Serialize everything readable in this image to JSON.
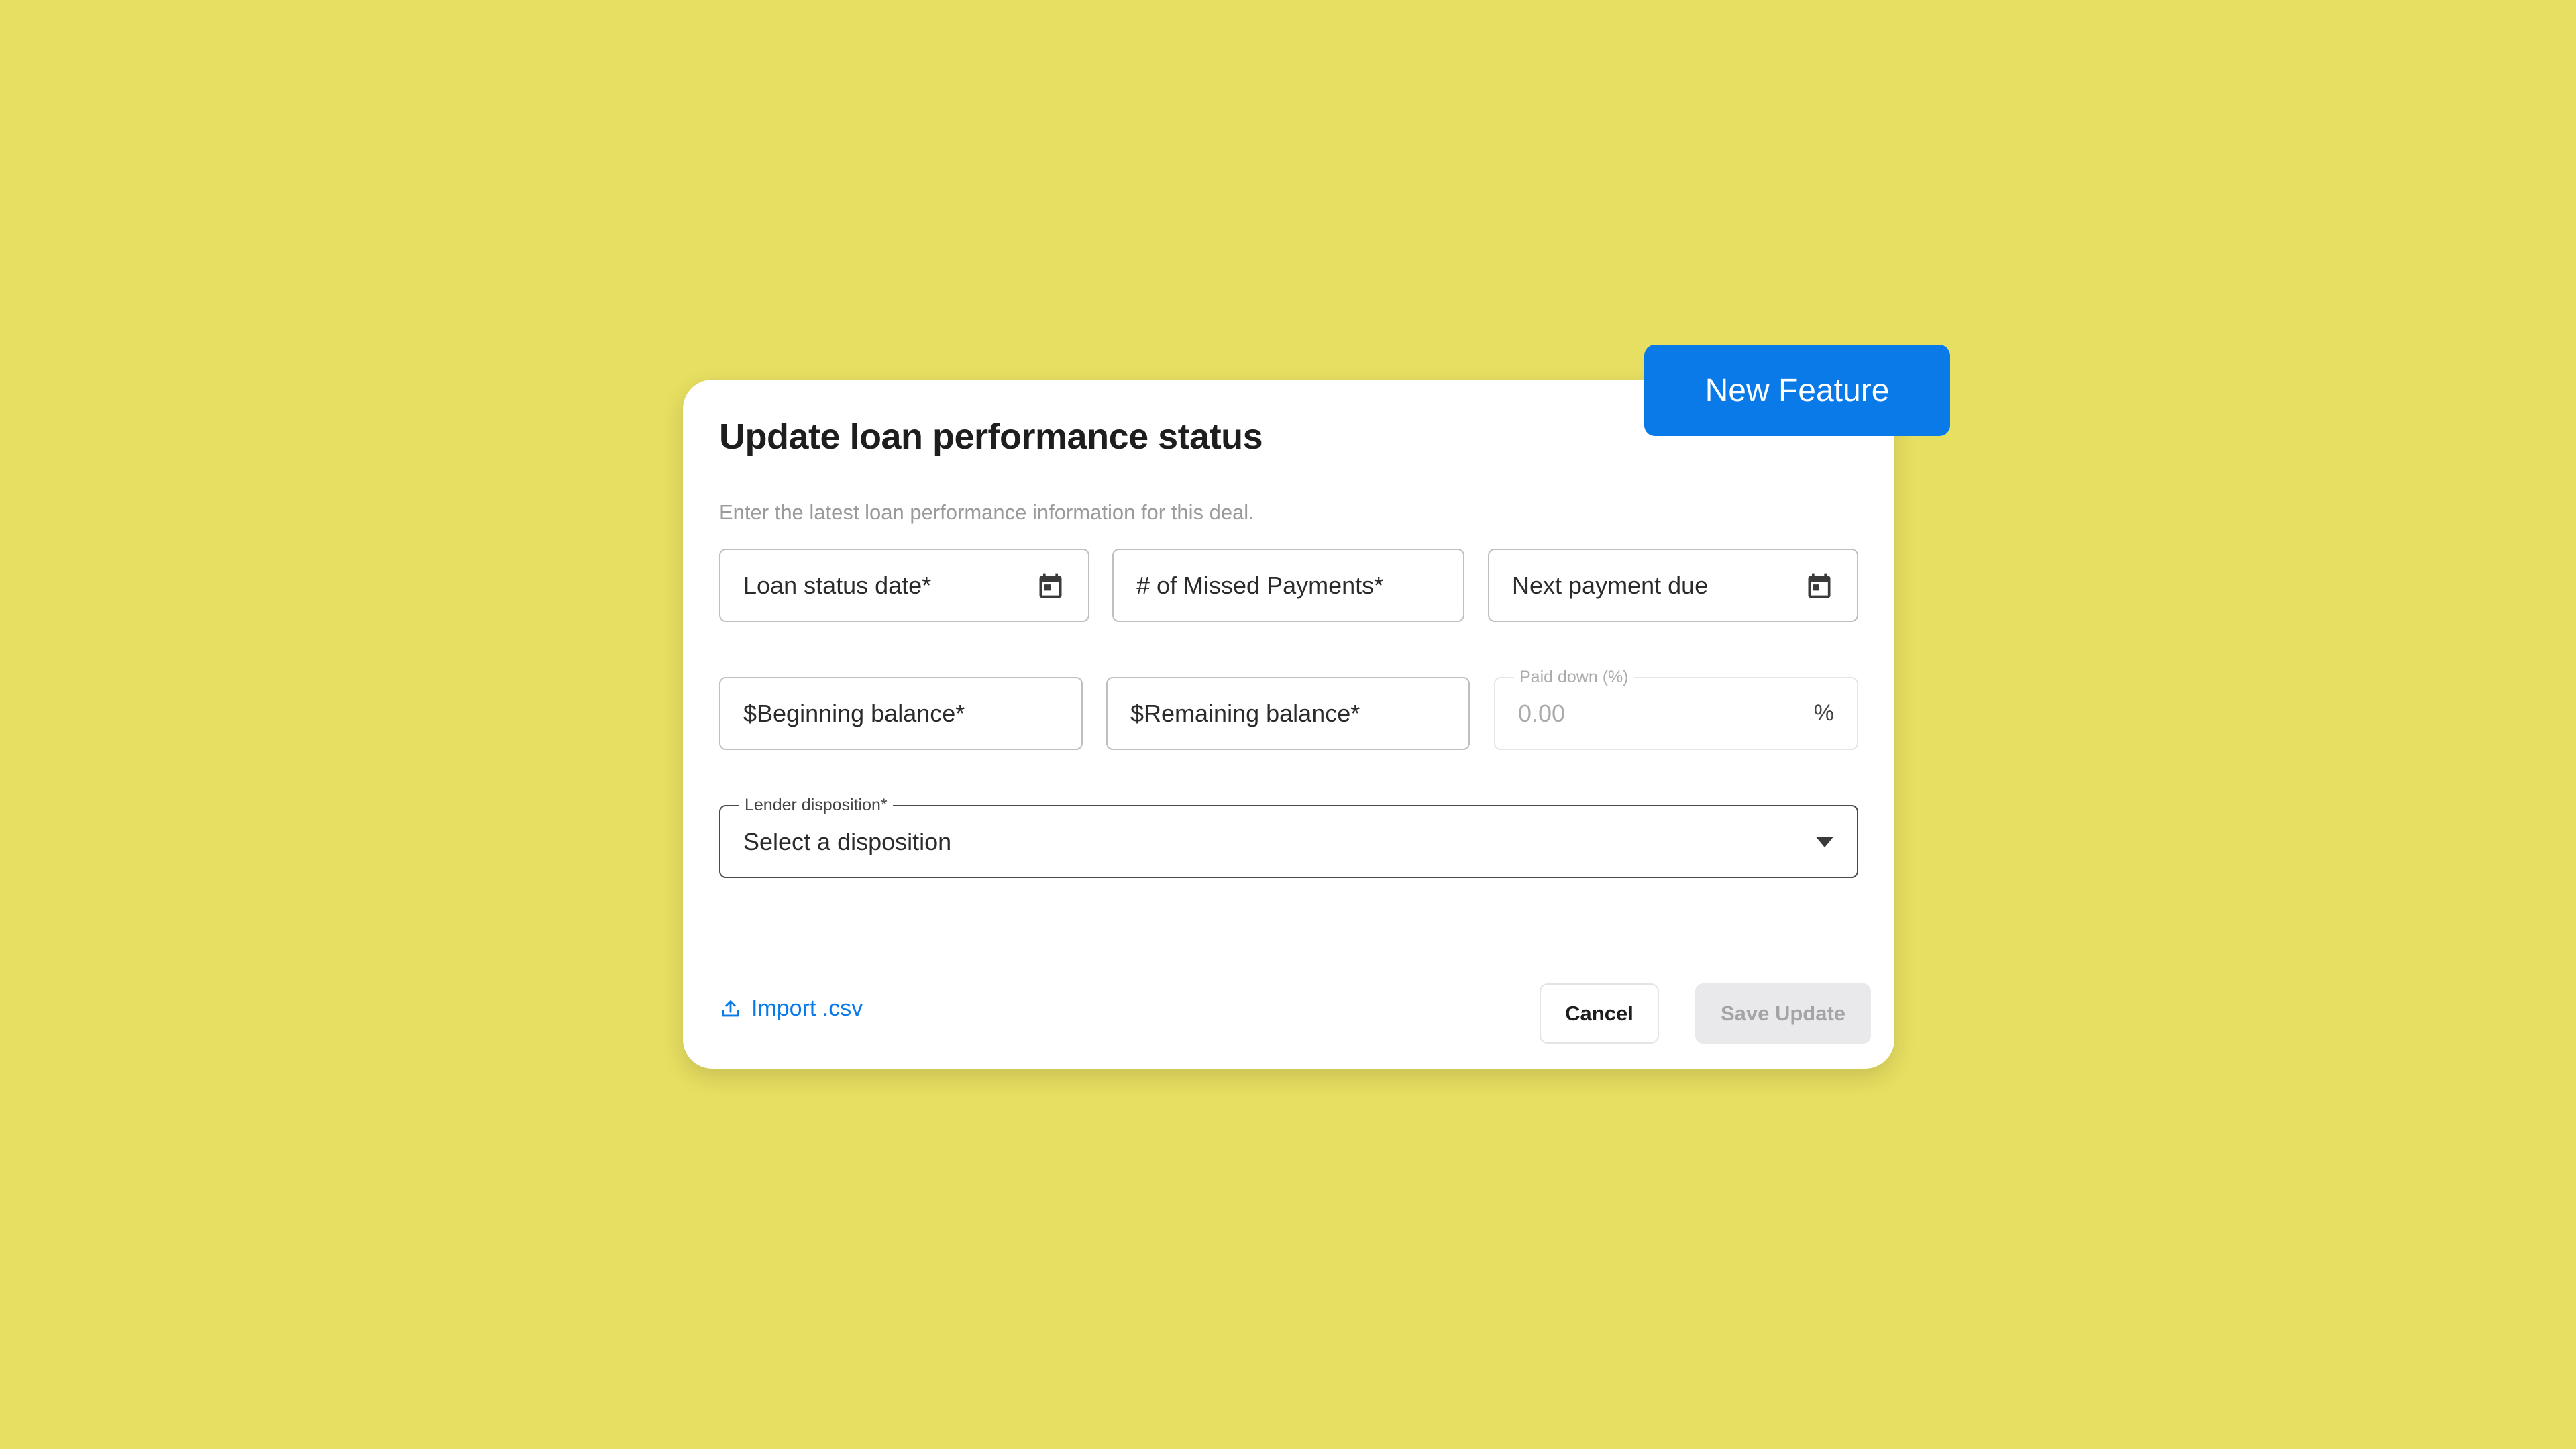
{
  "badge": {
    "label": "New Feature"
  },
  "dialog": {
    "title": "Update loan performance status",
    "subtitle": "Enter the latest loan performance information for this deal."
  },
  "fields": {
    "loan_status_date": {
      "placeholder": "Loan status date*",
      "icon": "calendar-icon"
    },
    "missed_payments": {
      "placeholder": "# of Missed Payments*"
    },
    "next_payment_due": {
      "placeholder": "Next payment due",
      "icon": "calendar-icon"
    },
    "beginning_balance": {
      "placeholder": "$Beginning balance*"
    },
    "remaining_balance": {
      "placeholder": "$Remaining balance*"
    },
    "paid_down": {
      "label": "Paid down (%)",
      "value": "0.00",
      "suffix": "%",
      "disabled": true
    },
    "lender_disposition": {
      "label": "Lender disposition*",
      "selected": "Select a disposition",
      "icon": "caret-down-icon"
    }
  },
  "footer": {
    "import_label": "Import .csv",
    "import_icon": "upload-icon",
    "cancel_label": "Cancel",
    "save_label": "Save Update"
  },
  "colors": {
    "background": "#E7DF61",
    "accent": "#0A7AE8",
    "disabled_button": "#E9E9EC"
  }
}
